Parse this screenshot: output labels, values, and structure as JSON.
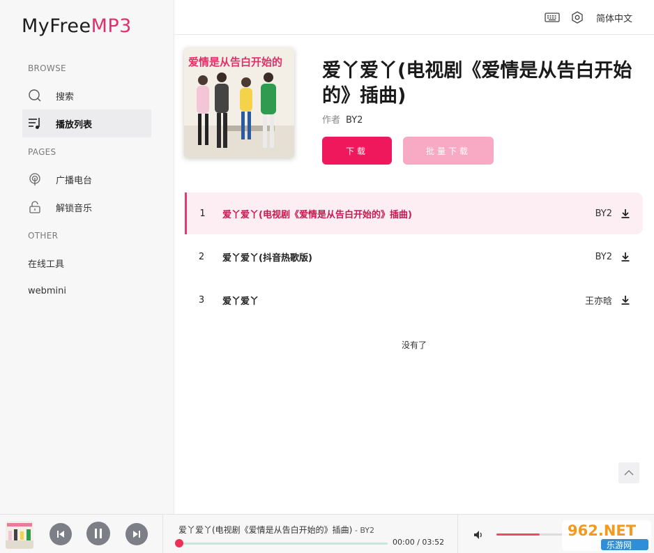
{
  "brand": {
    "part1": "MyFree",
    "part2": "MP3"
  },
  "sidebar": {
    "browse_title": "BROWSE",
    "pages_title": "PAGES",
    "other_title": "OTHER",
    "items": [
      {
        "label": "搜索",
        "icon": "search-icon"
      },
      {
        "label": "播放列表",
        "icon": "playlist-icon"
      },
      {
        "label": "广播电台",
        "icon": "radio-icon"
      },
      {
        "label": "解锁音乐",
        "icon": "unlock-icon"
      },
      {
        "label": "在线工具"
      },
      {
        "label": "webmini"
      }
    ]
  },
  "topbar": {
    "lang": "简体中文",
    "icons": [
      "keyboard-icon",
      "settings-icon"
    ]
  },
  "album": {
    "title": "爱丫爱丫(电视剧《爱情是从告白开始的》插曲)",
    "author_label": "作者",
    "author": "BY2",
    "download_label": "下载",
    "batch_download_label": "批量下载",
    "cover_text": "爱情是从告白开始的"
  },
  "tracks": [
    {
      "num": "1",
      "title": "爱丫爱丫(电视剧《爱情是从告白开始的》插曲)",
      "artist": "BY2"
    },
    {
      "num": "2",
      "title": "爱丫爱丫(抖音热歌版)",
      "artist": "BY2"
    },
    {
      "num": "3",
      "title": "爱丫爱丫",
      "artist": "王亦晗"
    }
  ],
  "no_more": "没有了",
  "player": {
    "title": "爱丫爱丫(电视剧《爱情是从告白开始的》插曲)",
    "artist_suffix": " - BY2",
    "time": "00:00 / 03:52",
    "progress": 0.0,
    "volume": 0.6
  },
  "watermark": {
    "top": "962.NET",
    "bottom": "乐游网"
  },
  "colors": {
    "accent": "#e0306a",
    "primary_btn": "#f0185c",
    "secondary_btn": "#f8a9c3",
    "active_row": "#fdeef3"
  }
}
